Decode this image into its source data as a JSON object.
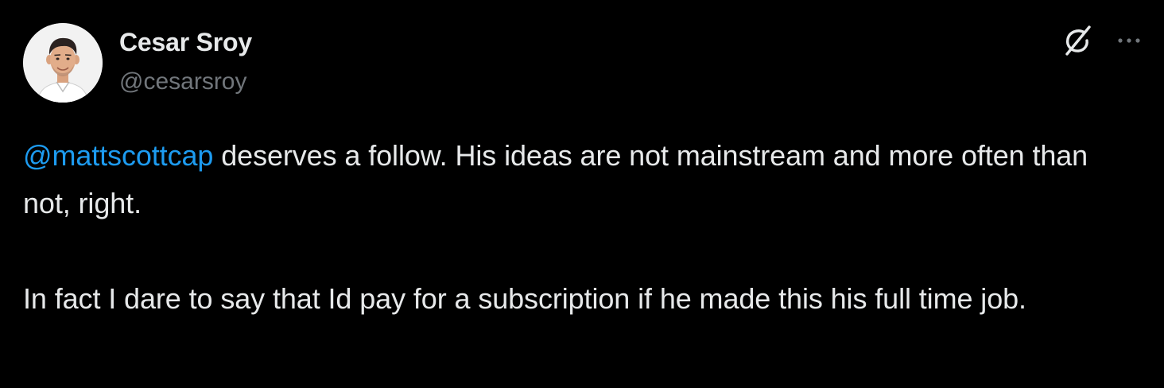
{
  "author": {
    "display_name": "Cesar Sroy",
    "handle": "@cesarsroy"
  },
  "tweet": {
    "mention": "@mattscottcap",
    "paragraph1_rest": " deserves a follow. His ideas are not mainstream and more often than not, right.",
    "paragraph2": "In fact I dare to say that Id pay for a subscription if he made this his full time job."
  },
  "icons": {
    "grok": "grok-icon",
    "more": "more-icon"
  },
  "colors": {
    "background": "#000000",
    "text": "#e7e9ea",
    "secondary_text": "#71767b",
    "link": "#1d9bf0"
  }
}
